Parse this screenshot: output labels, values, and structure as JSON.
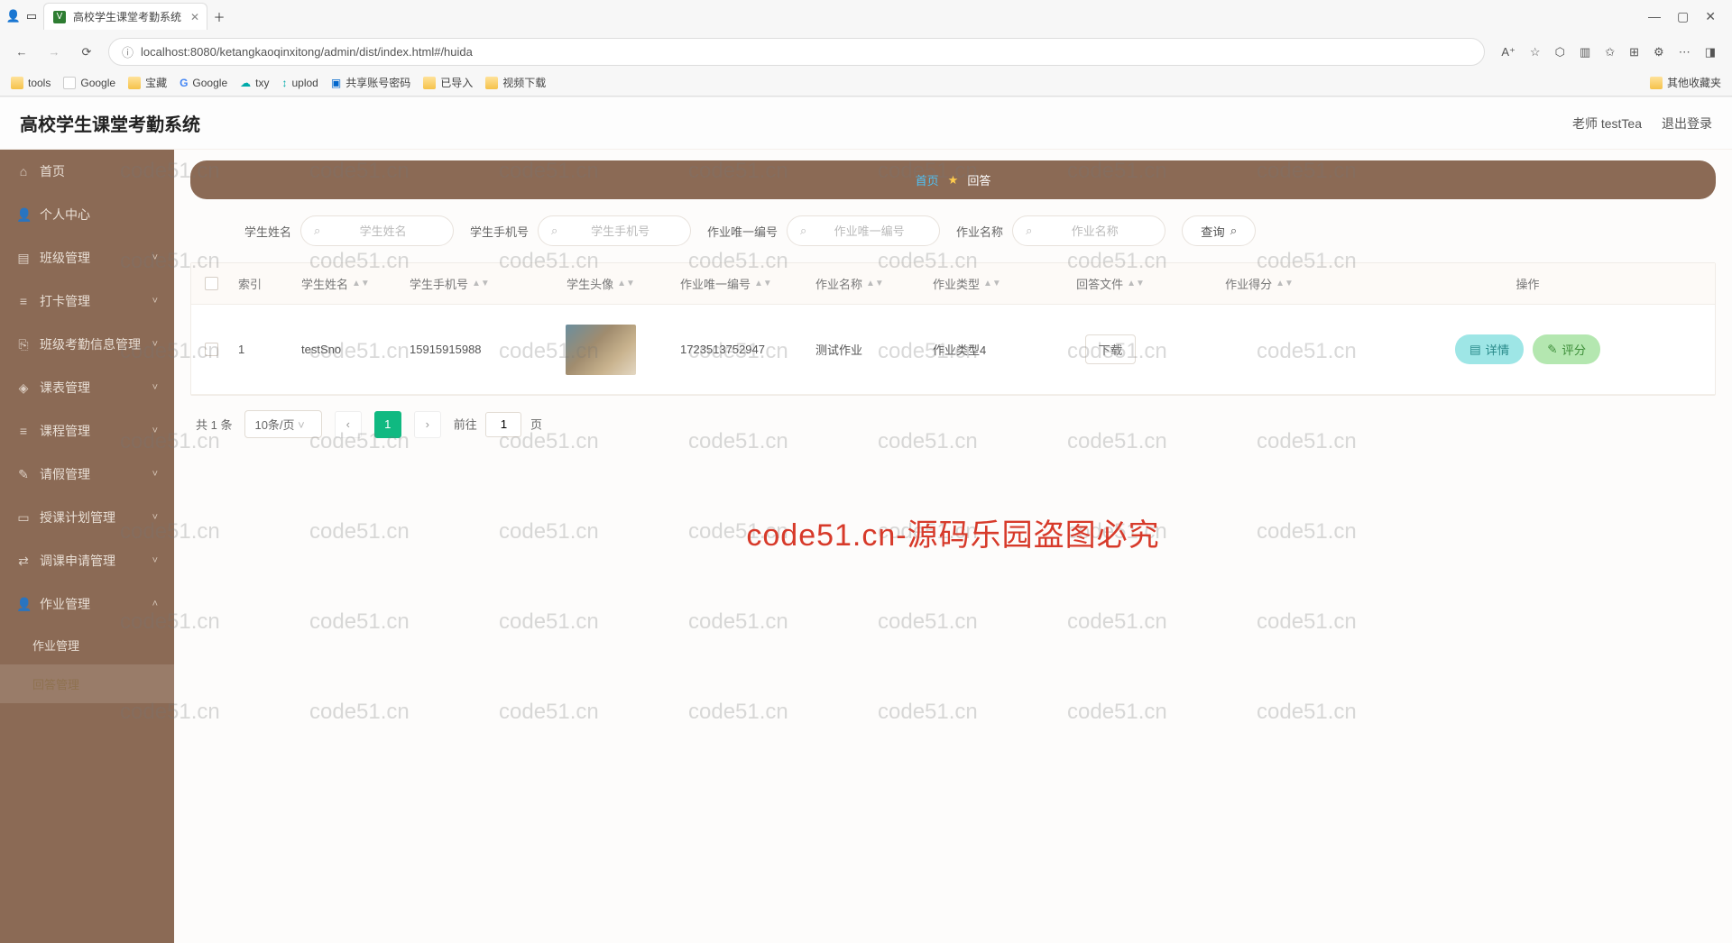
{
  "browser": {
    "tab_title": "高校学生课堂考勤系统",
    "url": "localhost:8080/ketangkaoqinxitong/admin/dist/index.html#/huida",
    "bookmarks": [
      "tools",
      "Google",
      "宝藏",
      "Google",
      "txy",
      "uplod",
      "共享账号密码",
      "已导入",
      "视频下载"
    ],
    "bm_right": "其他收藏夹"
  },
  "app": {
    "title": "高校学生课堂考勤系统",
    "user_label": "老师 testTea",
    "logout": "退出登录"
  },
  "sidebar": {
    "items": [
      {
        "icon": "🏠",
        "label": "首页"
      },
      {
        "icon": "👤",
        "label": "个人中心"
      },
      {
        "icon": "▤",
        "label": "班级管理",
        "chev": true
      },
      {
        "icon": "≡",
        "label": "打卡管理",
        "chev": true
      },
      {
        "icon": "⎘",
        "label": "班级考勤信息管理",
        "chev": true
      },
      {
        "icon": "◈",
        "label": "课表管理",
        "chev": true
      },
      {
        "icon": "≡",
        "label": "课程管理",
        "chev": true
      },
      {
        "icon": "✎",
        "label": "请假管理",
        "chev": true
      },
      {
        "icon": "▭",
        "label": "授课计划管理",
        "chev": true
      },
      {
        "icon": "⇄",
        "label": "调课申请管理",
        "chev": true
      },
      {
        "icon": "👤",
        "label": "作业管理",
        "chev": true,
        "expanded": true
      }
    ],
    "subs": [
      {
        "label": "作业管理"
      },
      {
        "label": "回答管理",
        "active": true
      }
    ]
  },
  "crumb": {
    "home": "首页",
    "current": "回答"
  },
  "filters": {
    "f1_label": "学生姓名",
    "f1_ph": "学生姓名",
    "f2_label": "学生手机号",
    "f2_ph": "学生手机号",
    "f3_label": "作业唯一编号",
    "f3_ph": "作业唯一编号",
    "f4_label": "作业名称",
    "f4_ph": "作业名称",
    "search": "查询"
  },
  "table": {
    "headers": [
      "",
      "索引",
      "学生姓名",
      "学生手机号",
      "学生头像",
      "作业唯一编号",
      "作业名称",
      "作业类型",
      "回答文件",
      "作业得分",
      "操作"
    ],
    "rows": [
      {
        "idx": "1",
        "name": "testSno",
        "phone": "15915915988",
        "hw_no": "1723513752947",
        "hw_name": "测试作业",
        "hw_type": "作业类型4",
        "file_btn": "下载",
        "score": "",
        "detail": "详情",
        "grade": "评分"
      }
    ]
  },
  "pager": {
    "total": "共 1 条",
    "size": "10条/页",
    "page": "1",
    "goto_prefix": "前往",
    "goto_val": "1",
    "goto_suffix": "页"
  },
  "watermark_text": "code51.cn",
  "watermark_big": "code51.cn-源码乐园盗图必究"
}
